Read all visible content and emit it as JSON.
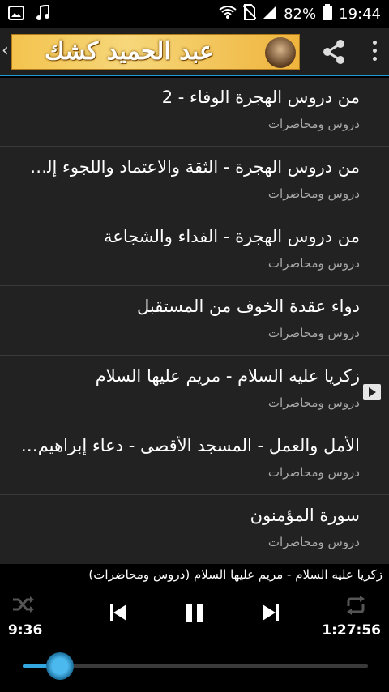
{
  "status_bar": {
    "battery": "82%",
    "time": "19:44"
  },
  "header": {
    "logo_text": "عبد الحميد كشك"
  },
  "tracks": [
    {
      "title": "من دروس الهجرة الوفاء - 2",
      "category": "دروس ومحاضرات",
      "playing": false
    },
    {
      "title": "من دروس الهجرة - الثقة والاعتماد واللجوء إلى ...",
      "category": "دروس ومحاضرات",
      "playing": false
    },
    {
      "title": "من دروس الهجرة - الفداء والشجاعة",
      "category": "دروس ومحاضرات",
      "playing": false
    },
    {
      "title": "دواء عقدة الخوف من المستقبل",
      "category": "دروس ومحاضرات",
      "playing": false
    },
    {
      "title": "زكريا عليه السلام - مريم عليها السلام",
      "category": "دروس ومحاضرات",
      "playing": true
    },
    {
      "title": "الأمل والعمل - المسجد الأقصى - دعاء إبراهيم ع...",
      "category": "دروس ومحاضرات",
      "playing": false
    },
    {
      "title": "سورة المؤمنون",
      "category": "دروس ومحاضرات",
      "playing": false
    }
  ],
  "player": {
    "now_playing": "زكريا عليه السلام - مريم عليها السلام (دروس ومحاضرات)",
    "elapsed": "9:36",
    "duration": "1:27:56",
    "progress_fraction": 0.109
  },
  "colors": {
    "accent": "#1d9ad6",
    "list_bg": "#222222",
    "subtitle": "#a8a8a8"
  }
}
